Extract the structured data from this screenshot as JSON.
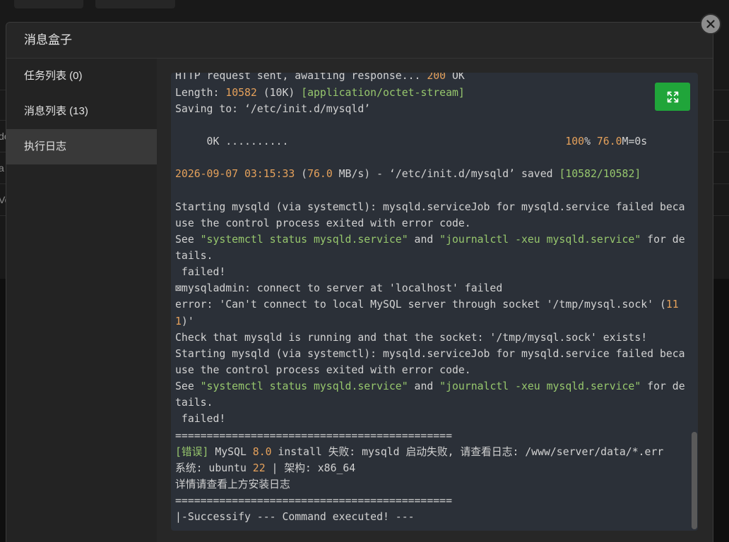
{
  "background": {
    "fragments": [
      "de",
      "a",
      "Ve"
    ]
  },
  "modal": {
    "title": "消息盒子",
    "close_icon": "close-icon"
  },
  "sidebar": {
    "items": [
      {
        "label": "任务列表 (0)",
        "active": false
      },
      {
        "label": "消息列表 (13)",
        "active": false
      },
      {
        "label": "执行日志",
        "active": true
      }
    ]
  },
  "log": {
    "expand_icon": "fullscreen-icon",
    "scroll_fraction": 1,
    "visible_fraction": 0.21,
    "lines": [
      [
        "HTTP request sent, awaiting response... ",
        [
          "200",
          "#e5a15b"
        ],
        " OK"
      ],
      [
        "Length: ",
        [
          "10582",
          "#e5a15b"
        ],
        " (10K) ",
        [
          "[application/octet-stream]",
          "#97c76d"
        ]
      ],
      [
        "Saving to: ‘/etc/init.d/mysqld’"
      ],
      [],
      [
        "     0K ..........                                            ",
        [
          "100",
          "#e5a15b"
        ],
        "% ",
        [
          "76.0",
          "#e5a15b"
        ],
        "M=0s"
      ],
      [],
      [
        [
          "2026-09-07 03:15:33",
          "#e5a15b"
        ],
        " (",
        [
          "76.0",
          "#e5a15b"
        ],
        " MB/s) - ‘/etc/init.d/mysqld’ saved ",
        [
          "[10582/10582]",
          "#97c76d"
        ]
      ],
      [],
      [
        "Starting mysqld (via systemctl): mysqld.serviceJob for mysqld.service failed beca"
      ],
      [
        "use the control process exited with error code."
      ],
      [
        "See ",
        [
          "\"systemctl status mysqld.service\"",
          "#97c76d"
        ],
        " and ",
        [
          "\"journalctl -xeu mysqld.service\"",
          "#97c76d"
        ],
        " for de"
      ],
      [
        "tails."
      ],
      [
        " failed!"
      ],
      [
        "⊠mysqladmin: connect to server at 'localhost' failed"
      ],
      [
        "error: 'Can't connect to local MySQL server through socket '/tmp/mysql.sock' (",
        [
          "11",
          "#e5a15b"
        ]
      ],
      [
        [
          "1",
          "#e5a15b"
        ],
        ")'"
      ],
      [
        "Check that mysqld is running and that the socket: '/tmp/mysql.sock' exists!"
      ],
      [
        "Starting mysqld (via systemctl): mysqld.serviceJob for mysqld.service failed beca"
      ],
      [
        "use the control process exited with error code."
      ],
      [
        "See ",
        [
          "\"systemctl status mysqld.service\"",
          "#97c76d"
        ],
        " and ",
        [
          "\"journalctl -xeu mysqld.service\"",
          "#97c76d"
        ],
        " for de"
      ],
      [
        "tails."
      ],
      [
        " failed!"
      ],
      [
        "============================================"
      ],
      [
        [
          "[错误]",
          "#97c76d"
        ],
        " MySQL ",
        [
          "8.0",
          "#e5a15b"
        ],
        " install 失败: mysqld 启动失败, 请查看日志: /www/server/data/*.err"
      ],
      [
        "系统: ubuntu ",
        [
          "22",
          "#e5a15b"
        ],
        " | 架构: x86_64"
      ],
      [
        "详情请查看上方安装日志"
      ],
      [
        "============================================"
      ],
      [
        "|-Successify --- Command executed! ---"
      ]
    ]
  },
  "colors": {
    "accent": "#20a53a",
    "log_text": "#d2d2d2",
    "log_background": "#2b3038",
    "log_number": "#e5a15b",
    "log_string": "#97c76d"
  }
}
